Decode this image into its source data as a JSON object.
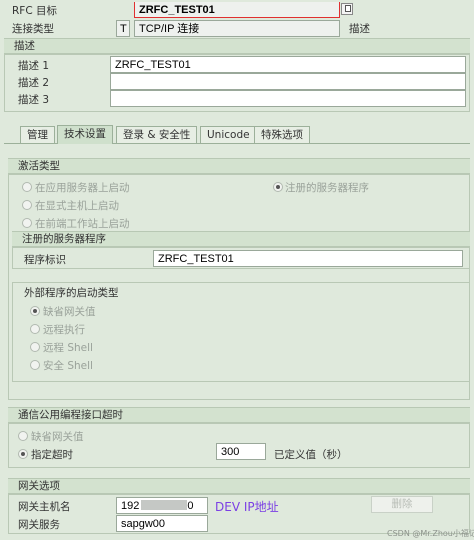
{
  "header": {
    "rfc_target_label": "RFC 目标",
    "rfc_target_value": "ZRFC_TEST01",
    "connection_type_label": "连接类型",
    "connection_type_code": "T",
    "connection_type_value": "TCP/IP 连接",
    "description_short_label": "描述"
  },
  "description": {
    "section_title": "描述",
    "rows": [
      {
        "label": "描述 1",
        "value": "ZRFC_TEST01"
      },
      {
        "label": "描述 2",
        "value": ""
      },
      {
        "label": "描述 3",
        "value": ""
      }
    ]
  },
  "tabs": [
    "管理",
    "技术设置",
    "登录 & 安全性",
    "Unicode",
    "特殊选项"
  ],
  "activation": {
    "title": "激活类型",
    "options": [
      "在应用服务器上启动",
      "注册的服务器程序",
      "在显式主机上启动",
      "在前端工作站上启动"
    ]
  },
  "registered_program": {
    "title": "注册的服务器程序",
    "program_id_label": "程序标识",
    "program_id_value": "ZRFC_TEST01"
  },
  "start_type": {
    "title": "外部程序的启动类型",
    "options": [
      "缺省网关值",
      "远程执行",
      "远程 Shell",
      "安全 Shell"
    ]
  },
  "cpic_timeout": {
    "title": "通信公用编程接口超时",
    "options": [
      "缺省网关值",
      "指定超时"
    ],
    "timeout_value": "300",
    "timeout_label": "已定义值（秒）"
  },
  "gateway": {
    "title": "网关选项",
    "host_label": "网关主机名",
    "host_value_partial": "192",
    "host_value_end": "0",
    "annotation": "DEV IP地址",
    "service_label": "网关服务",
    "service_value": "sapgw00",
    "delete_button": "删除"
  },
  "watermark": "CSDN @Mr.Zhou小福记",
  "colors": {
    "annotation": "#7b3fe4",
    "highlight_border": "#e03030"
  }
}
